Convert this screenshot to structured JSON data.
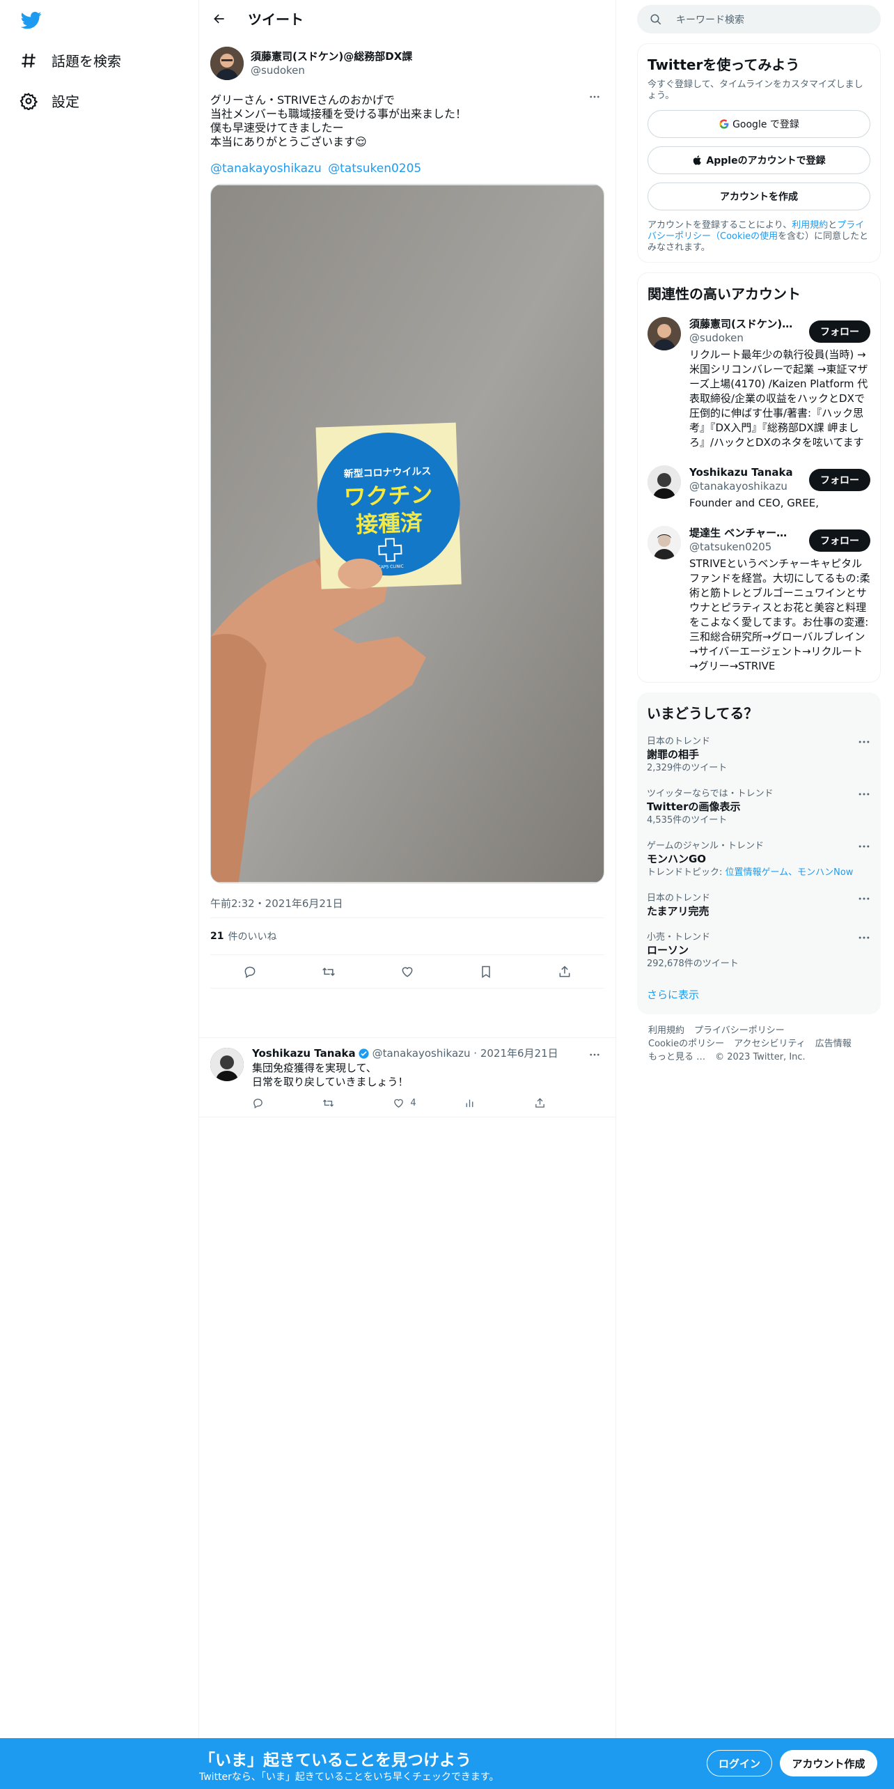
{
  "left_nav": {
    "items": [
      {
        "label": "話題を検索",
        "icon": "hashtag-icon"
      },
      {
        "label": "設定",
        "icon": "gear-icon"
      }
    ]
  },
  "header": {
    "title": "ツイート"
  },
  "tweet": {
    "author_name": "須藤憲司(スドケン)@総務部DX課",
    "author_handle": "@sudoken",
    "text": "グリーさん・STRIVEさんのおかげで\n当社メンバーも職域接種を受ける事が出来ました！\n僕も早速受けてきましたー\n本当にありがとうございます😌",
    "mentions": [
      "@tanakayoshikazu",
      "@tatsuken0205"
    ],
    "sticker": {
      "line1": "新型コロナウイルス",
      "line2": "ワクチン",
      "line3": "接種済",
      "line4": "CAPS CLINIC"
    },
    "timestamp": "午前2:32・2021年6月21日",
    "likes_count": "21",
    "likes_label": "件のいいね"
  },
  "reply": {
    "author_name": "Yoshikazu Tanaka",
    "handle_date": "@tanakayoshikazu · 2021年6月21日",
    "text": "集団免疫獲得を実現して、\n日常を取り戻していきましょう！",
    "likes": "4"
  },
  "right": {
    "search_placeholder": "キーワード検索",
    "signup": {
      "title": "Twitterを使ってみよう",
      "subtitle": "今すぐ登録して、タイムラインをカスタマイズしましょう。",
      "google": "Google で登録",
      "apple": "Appleのアカウントで登録",
      "create": "アカウントを作成",
      "terms_1": "アカウントを登録することにより、",
      "terms_link1": "利用規約",
      "terms_2": "と",
      "terms_link2": "プライバシーポリシー（Cookieの使用",
      "terms_3": "を含む）に同意したとみなされます。"
    },
    "related": {
      "title": "関連性の高いアカウント",
      "follow_label": "フォロー",
      "accounts": [
        {
          "name": "須藤憲司(スドケン)@総務部DX課",
          "handle": "@sudoken",
          "bio": "リクルート最年少の執行役員(当時) →米国シリコンバレーで起業 →東証マザーズ上場(4170) /Kaizen Platform 代表取締役/企業の収益をハックとDXで圧倒的に伸ばす仕事/著書:『ハック思考』『DX入門』『総務部DX課 岬ましろ』/ハックとDXのネタを呟いてます"
        },
        {
          "name": "Yoshikazu Tanaka",
          "handle": "@tanakayoshikazu",
          "bio": "Founder and CEO, GREE,"
        },
        {
          "name": "堤達生 ベンチャーキャピタリスト",
          "handle": "@tatsuken0205",
          "bio": "STRIVEというベンチャーキャピタルファンドを経営。大切にしてるもの:柔術と筋トレとブルゴーニュワインとサウナとピラティスとお花と美容と料理をこよなく愛してます。お仕事の変遷:三和総合研究所→グローバルブレイン→サイバーエージェント→リクルート→グリー→STRIVE"
        }
      ]
    },
    "trends": {
      "title": "いまどうしてる？",
      "items": [
        {
          "context": "日本のトレンド",
          "name": "謝罪の相手",
          "meta": "2,329件のツイート"
        },
        {
          "context": "ツイッターならでは・トレンド",
          "name": "Twitterの画像表示",
          "meta": "4,535件のツイート"
        },
        {
          "context": "ゲームのジャンル・トレンド",
          "name": "モンハンGO",
          "meta": "トレンドトピック: ",
          "links": "位置情報ゲーム、モンハンNow"
        },
        {
          "context": "日本のトレンド",
          "name": "たまアリ完売",
          "meta": ""
        },
        {
          "context": "小売・トレンド",
          "name": "ローソン",
          "meta": "292,678件のツイート"
        }
      ],
      "show_more": "さらに表示"
    },
    "footer": {
      "links": [
        "利用規約",
        "プライバシーポリシー",
        "Cookieのポリシー",
        "アクセシビリティ",
        "広告情報",
        "もっと見る …"
      ],
      "copyright": "© 2023 Twitter, Inc."
    }
  },
  "banner": {
    "title": "「いま」起きていることを見つけよう",
    "subtitle": "Twitterなら、「いま」起きていることをいち早くチェックできます。",
    "login": "ログイン",
    "signup": "アカウント作成"
  },
  "colors": {
    "accent": "#1d9bf0",
    "text": "#0f1419",
    "muted": "#536471"
  }
}
